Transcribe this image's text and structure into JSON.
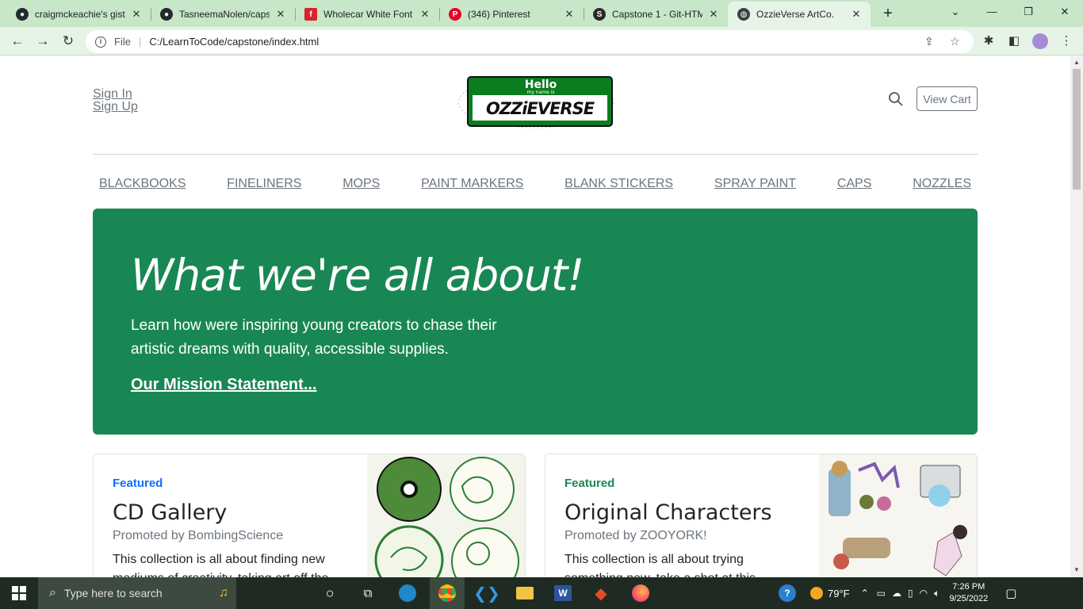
{
  "browser": {
    "tabs": [
      {
        "label": "craigmckeachie's gists",
        "icon": "github-icon",
        "active": false
      },
      {
        "label": "TasneemaNolen/capst",
        "icon": "github-icon",
        "active": false
      },
      {
        "label": "Wholecar White Font",
        "icon": "font-site-icon",
        "active": false
      },
      {
        "label": "(346) Pinterest",
        "icon": "pinterest-icon",
        "active": false
      },
      {
        "label": "Capstone 1 - Git-HTM",
        "icon": "skillshare-icon",
        "active": false
      },
      {
        "label": "OzzieVerse ArtCo.",
        "icon": "globe-icon",
        "active": true
      }
    ],
    "address": {
      "scheme_label": "File",
      "url": "C:/LearnToCode/capstone/index.html"
    }
  },
  "header": {
    "sign_in": "Sign In",
    "sign_up": "Sign Up",
    "logo": {
      "top_text": "Hello",
      "sub_text": "my name is",
      "name_text": "OZZiEVERSE"
    },
    "view_cart": "View Cart"
  },
  "nav": {
    "items": [
      "BLACKBOOKS",
      "FINELINERS",
      "MOPS",
      "PAINT MARKERS",
      "BLANK STICKERS",
      "SPRAY PAINT",
      "CAPS",
      "NOZZLES"
    ]
  },
  "hero": {
    "title": "What we're all about!",
    "body": "Learn how were inspiring young creators to chase their artistic dreams with quality, accessible supplies.",
    "link": "Our Mission Statement..."
  },
  "cards": [
    {
      "tag": "Featured",
      "tag_color": "#0d6efd",
      "title": "CD Gallery",
      "promo": "Promoted by BombingScience",
      "desc": "This collection is all about finding new mediums of creativity, taking art off the"
    },
    {
      "tag": "Featured",
      "tag_color": "#198754",
      "title": "Original Characters",
      "promo": "Promoted by ZOOYORK!",
      "desc": "This collection is all about trying something new, take a shot at this"
    }
  ],
  "taskbar": {
    "search_placeholder": "Type here to search",
    "weather": "79°F",
    "time": "7:26 PM",
    "date": "9/25/2022"
  },
  "colors": {
    "accent_green": "#198754",
    "tab_strip": "#c7e7c8"
  }
}
